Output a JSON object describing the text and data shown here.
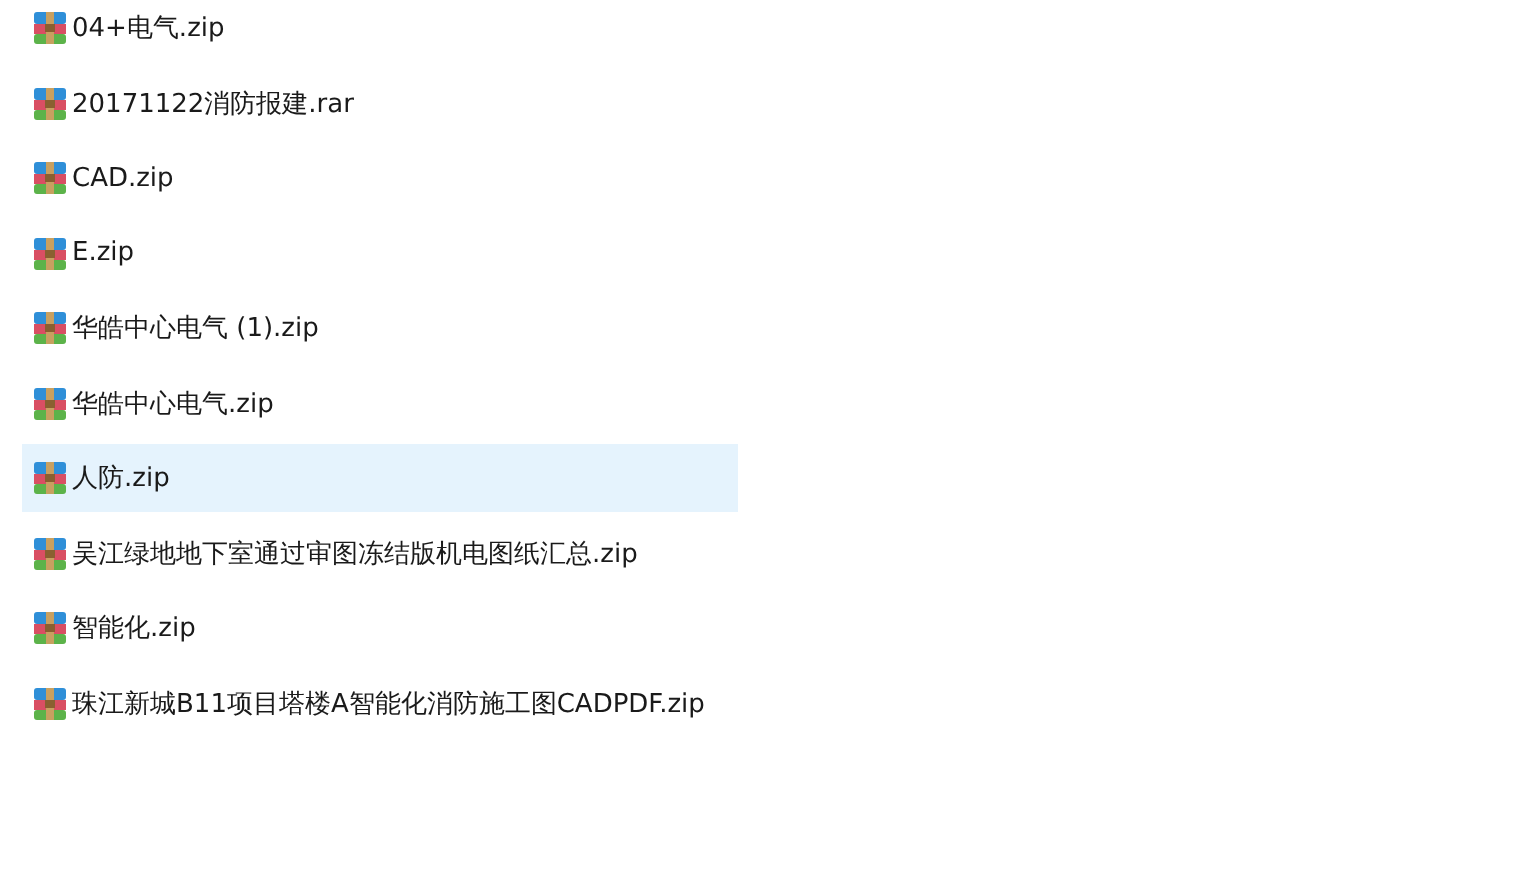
{
  "files": [
    {
      "name": "04+电气.zip",
      "selected": false
    },
    {
      "name": "20171122消防报建.rar",
      "selected": false
    },
    {
      "name": "CAD.zip",
      "selected": false
    },
    {
      "name": "E.zip",
      "selected": false
    },
    {
      "name": "华皓中心电气 (1).zip",
      "selected": false
    },
    {
      "name": "华皓中心电气.zip",
      "selected": false
    },
    {
      "name": "人防.zip",
      "selected": true
    },
    {
      "name": "吴江绿地地下室通过审图冻结版机电图纸汇总.zip",
      "selected": false
    },
    {
      "name": "智能化.zip",
      "selected": false
    },
    {
      "name": "珠江新城B11项目塔楼A智能化消防施工图CADPDF.zip",
      "selected": false
    }
  ]
}
